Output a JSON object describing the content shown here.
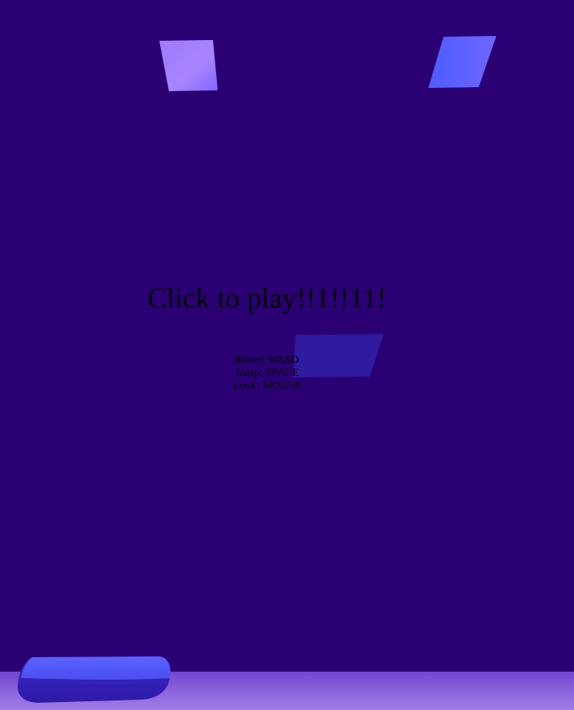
{
  "prompt": {
    "title": "Click to play!!1!!11!",
    "controls": [
      "Move: WASD",
      "Jump: SPACE",
      "Look: MOUSE"
    ]
  },
  "colors": {
    "sky": "#2a0073",
    "ground": "#8a5ae0",
    "platform_light": "#a27dff",
    "platform_blue": "#5b60ff",
    "platform_dim": "#341aa8",
    "text": "#000000"
  }
}
